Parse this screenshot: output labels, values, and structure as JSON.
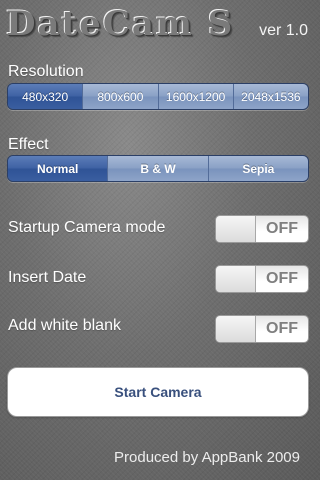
{
  "app": {
    "title": "DateCam S",
    "version": "ver 1.0"
  },
  "resolution": {
    "label": "Resolution",
    "options": [
      "480x320",
      "800x600",
      "1600x1200",
      "2048x1536"
    ],
    "selected": "480x320"
  },
  "effect": {
    "label": "Effect",
    "options": [
      "Normal",
      "B & W",
      "Sepia"
    ],
    "selected": "Normal"
  },
  "settings": [
    {
      "label": "Startup Camera mode",
      "state": "OFF"
    },
    {
      "label": "Insert Date",
      "state": "OFF"
    },
    {
      "label": "Add white blank",
      "state": "OFF"
    }
  ],
  "start_button": {
    "label": "Start Camera"
  },
  "credit": "Produced by AppBank 2009",
  "colors": {
    "segment_selected": "#3f62a4",
    "segment_normal": "#8aa1c6",
    "button_text": "#39507d"
  }
}
